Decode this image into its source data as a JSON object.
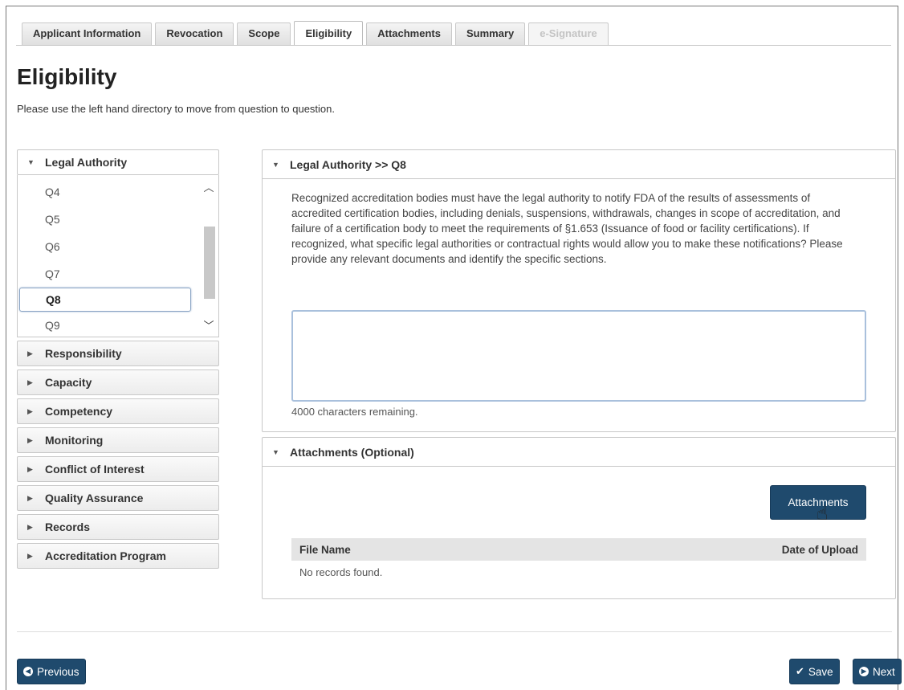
{
  "tabs": [
    {
      "label": "Applicant Information"
    },
    {
      "label": "Revocation"
    },
    {
      "label": "Scope"
    },
    {
      "label": "Eligibility"
    },
    {
      "label": "Attachments"
    },
    {
      "label": "Summary"
    },
    {
      "label": "e-Signature"
    }
  ],
  "active_tab": "Eligibility",
  "page": {
    "title": "Eligibility",
    "instructions": "Please use the left hand directory to move from question to question."
  },
  "sidebar": {
    "open_section": "Legal Authority",
    "questions": [
      "Q4",
      "Q5",
      "Q6",
      "Q7",
      "Q8",
      "Q9"
    ],
    "selected_question": "Q8",
    "sections": [
      {
        "label": "Responsibility"
      },
      {
        "label": "Capacity"
      },
      {
        "label": "Competency"
      },
      {
        "label": "Monitoring"
      },
      {
        "label": "Conflict of Interest"
      },
      {
        "label": "Quality Assurance"
      },
      {
        "label": "Records"
      },
      {
        "label": "Accreditation Program"
      }
    ]
  },
  "question_panel": {
    "header": "Legal Authority >> Q8",
    "text": "Recognized accreditation bodies must have the legal authority to notify FDA of the results of assessments of accredited certification bodies, including denials, suspensions, withdrawals, changes in scope of accreditation, and failure of a certification body to meet the requirements of §1.653 (Issuance of food or facility certifications). If recognized, what specific legal authorities or contractual rights would allow you to make these notifications? Please provide any relevant documents and identify the specific sections.",
    "answer_value": "",
    "chars_remaining": "4000 characters remaining."
  },
  "attachments_panel": {
    "header": "Attachments (Optional)",
    "button_label": "Attachments",
    "columns": [
      "File Name",
      "Date of Upload"
    ],
    "empty_message": "No records found."
  },
  "footer": {
    "previous_label": "Previous",
    "save_label": "Save",
    "next_label": "Next"
  },
  "colors": {
    "primary_button": "#1f4a6d",
    "focus_border": "#a9c0dc"
  }
}
